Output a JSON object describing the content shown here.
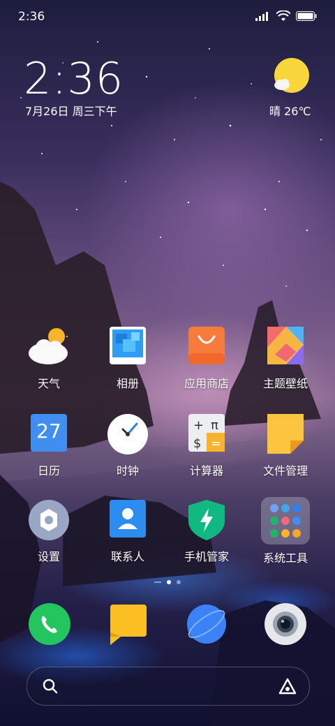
{
  "status_bar": {
    "time": "2:36"
  },
  "clock_widget": {
    "time": "2:36",
    "date": "7月26日 周三下午"
  },
  "weather_widget": {
    "text": "晴 26℃",
    "icon": "sun-cloud-icon"
  },
  "apps": [
    {
      "label": "天气",
      "icon": "weather-app-icon"
    },
    {
      "label": "相册",
      "icon": "gallery-app-icon"
    },
    {
      "label": "应用商店",
      "icon": "app-store-icon"
    },
    {
      "label": "主题壁纸",
      "icon": "themes-app-icon"
    },
    {
      "label": "日历",
      "icon": "calendar-app-icon",
      "badge": "27"
    },
    {
      "label": "时钟",
      "icon": "clock-app-icon"
    },
    {
      "label": "计算器",
      "icon": "calculator-app-icon"
    },
    {
      "label": "文件管理",
      "icon": "file-manager-icon"
    },
    {
      "label": "设置",
      "icon": "settings-app-icon"
    },
    {
      "label": "联系人",
      "icon": "contacts-app-icon"
    },
    {
      "label": "手机管家",
      "icon": "security-app-icon"
    },
    {
      "label": "系统工具",
      "icon": "system-tools-folder-icon"
    }
  ],
  "page_indicator": {
    "current": 1,
    "pages": 2
  },
  "dock": [
    {
      "icon": "phone-app-icon"
    },
    {
      "icon": "messages-app-icon"
    },
    {
      "icon": "browser-app-icon"
    },
    {
      "icon": "camera-app-icon"
    }
  ],
  "search_bar": {
    "left_icon": "search-icon",
    "right_icon": "assistant-icon"
  },
  "colors": {
    "phone_green": "#22c55e",
    "messages_yellow": "#fbbf24",
    "browser_blue": "#3b82f6",
    "security_green": "#10b981"
  }
}
